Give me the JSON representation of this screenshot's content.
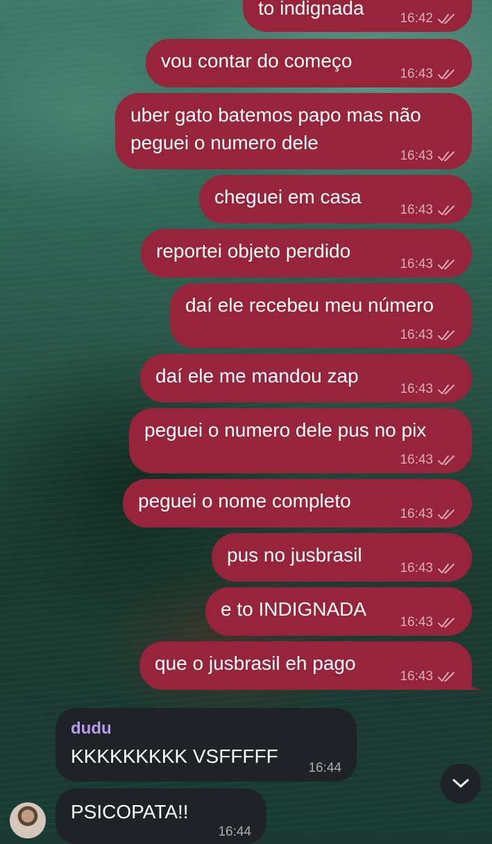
{
  "outgoing_messages": [
    {
      "text": "to indignada",
      "time": "16:42"
    },
    {
      "text": "vou contar do começo",
      "time": "16:43"
    },
    {
      "text": "uber gato batemos papo mas não",
      "text2": "peguei o numero dele",
      "time": "16:43"
    },
    {
      "text": "cheguei em casa",
      "time": "16:43"
    },
    {
      "text": "reportei objeto perdido",
      "time": "16:43"
    },
    {
      "text": "daí ele recebeu meu número",
      "time": "16:43"
    },
    {
      "text": "daí ele me mandou zap",
      "time": "16:43"
    },
    {
      "text": "peguei o numero dele pus no pix",
      "time": "16:43"
    },
    {
      "text": "peguei o nome completo",
      "time": "16:43"
    },
    {
      "text": "pus no jusbrasil",
      "time": "16:43"
    },
    {
      "text": "e to INDIGNADA",
      "time": "16:43"
    },
    {
      "text": "que o jusbrasil eh pago",
      "time": "16:43"
    }
  ],
  "incoming_messages": [
    {
      "sender": "dudu",
      "text": "KKKKKKKKK VSFFFFF",
      "time": "16:44"
    },
    {
      "text": "PSICOPATA!!",
      "time": "16:44"
    }
  ],
  "icons": {
    "read_receipt": "double-check-icon",
    "scroll_down": "chevron-down-icon"
  },
  "colors": {
    "outgoing_bubble": "#97243a",
    "incoming_bubble": "#1f2226",
    "sender_name": "#b79cf0"
  }
}
